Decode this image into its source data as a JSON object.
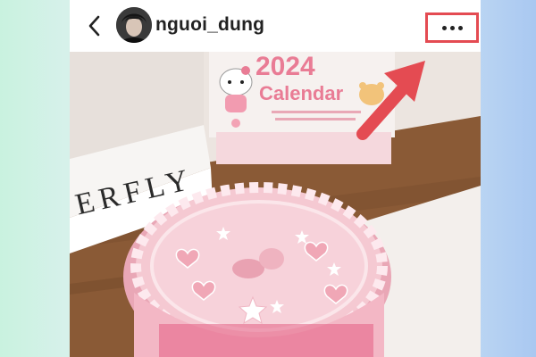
{
  "post": {
    "username": "nguoi_dung",
    "photo_texts": {
      "calendar_year": "2024",
      "calendar_label": "Calendar",
      "box_text": "ERFLY"
    }
  },
  "icons": {
    "back": "chevron-left-icon",
    "more": "more-horizontal-icon",
    "highlight_arrow": "arrow-pointer-icon"
  },
  "colors": {
    "highlight": "#e44b52",
    "cake_pink": "#f2b9c5",
    "calendar_pink": "#e97c95"
  }
}
